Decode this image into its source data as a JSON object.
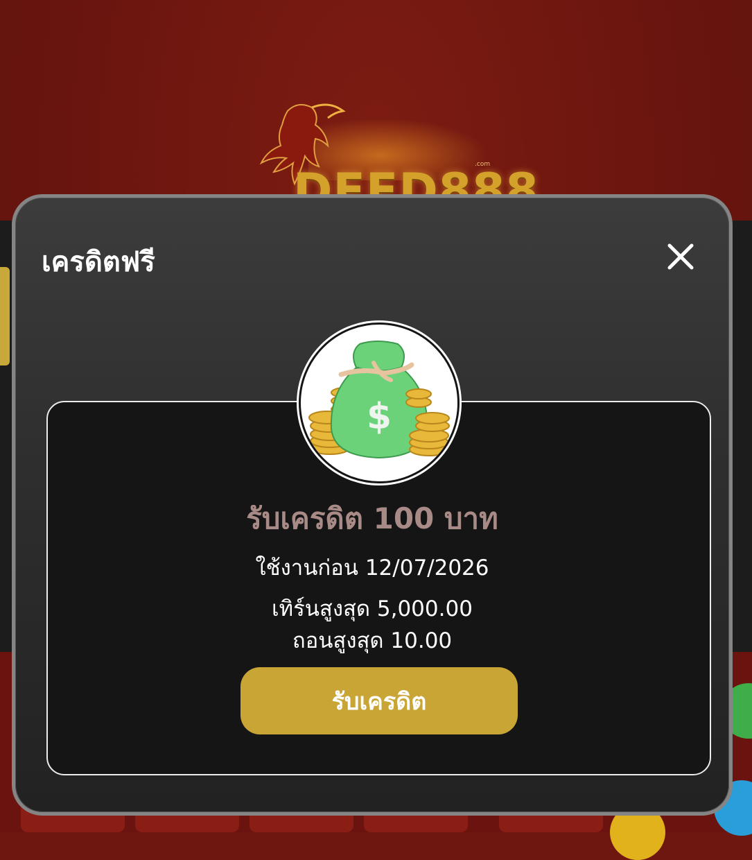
{
  "brand": {
    "logo_text": "DEED888",
    "logo_suffix": ".com"
  },
  "modal": {
    "title": "เครดิตฟรี",
    "close_icon": "close-icon",
    "reward_icon": "money-bag-icon",
    "credit_title": "รับเครดิต 100 บาท",
    "use_before": "ใช้งานก่อน 12/07/2026",
    "max_turnover": "เทิร์นสูงสุด 5,000.00",
    "max_withdraw": "ถอนสูงสุด 10.00",
    "claim_button": "รับเครดิต"
  },
  "colors": {
    "background": "#6e1710",
    "modal_border": "#858585",
    "accent_gold": "#c9a536",
    "credit_title": "#a88a86"
  }
}
